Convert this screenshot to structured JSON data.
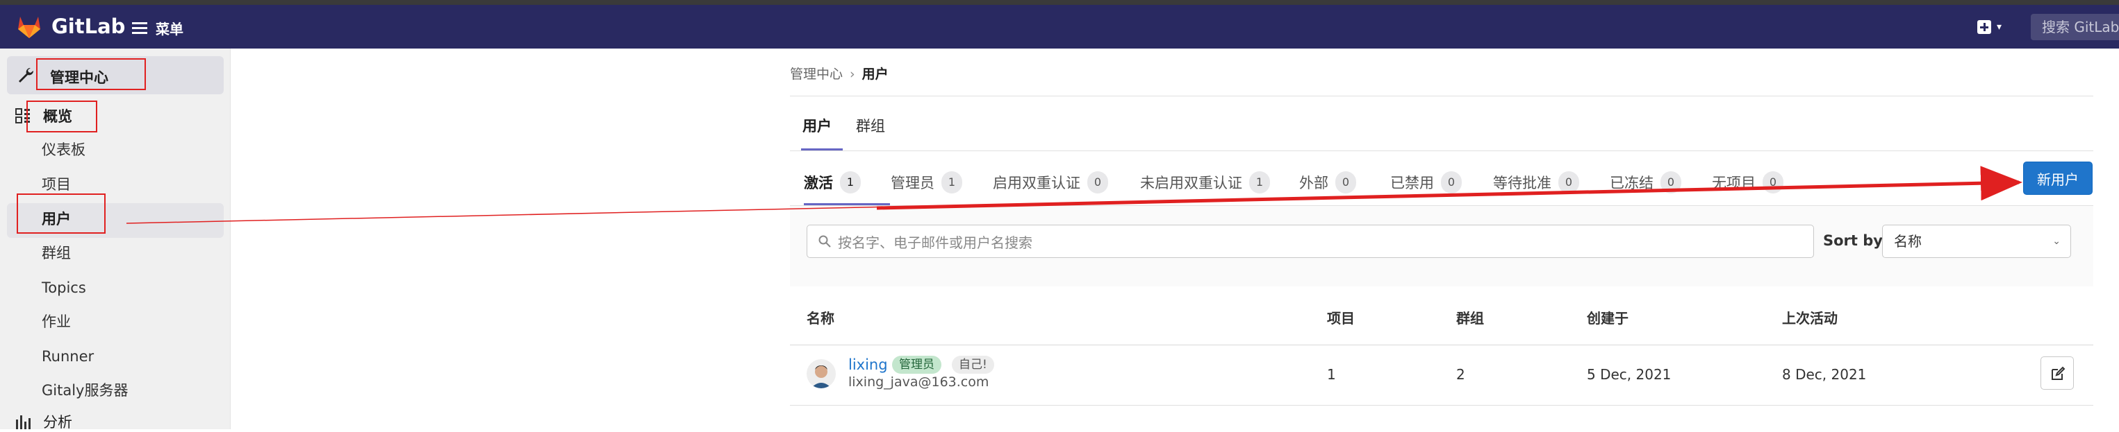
{
  "navbar": {
    "brand": "GitLab",
    "menu_label": "菜单",
    "search_placeholder": "搜索 GitLab"
  },
  "sidebar": {
    "title": "管理中心",
    "section": "概览",
    "items": [
      "仪表板",
      "项目",
      "用户",
      "群组",
      "Topics",
      "作业",
      "Runner",
      "Gitaly服务器"
    ],
    "next_section": "分析"
  },
  "breadcrumb": {
    "parent": "管理中心",
    "current": "用户"
  },
  "top_tabs": [
    "用户",
    "群组"
  ],
  "filter_tabs": [
    {
      "label": "激活",
      "count": "1"
    },
    {
      "label": "管理员",
      "count": "1"
    },
    {
      "label": "启用双重认证",
      "count": "0"
    },
    {
      "label": "未启用双重认证",
      "count": "1"
    },
    {
      "label": "外部",
      "count": "0"
    },
    {
      "label": "已禁用",
      "count": "0"
    },
    {
      "label": "等待批准",
      "count": "0"
    },
    {
      "label": "已冻结",
      "count": "0"
    },
    {
      "label": "无项目",
      "count": "0"
    }
  ],
  "new_user_label": "新用户",
  "search": {
    "placeholder": "按名字、电子邮件或用户名搜索"
  },
  "sort": {
    "label": "Sort by",
    "value": "名称"
  },
  "table": {
    "headers": [
      "名称",
      "项目",
      "群组",
      "创建于",
      "上次活动"
    ],
    "rows": [
      {
        "name": "lixing",
        "admin_badge": "管理员",
        "self_badge": "自己!",
        "email": "lixing_java@163.com",
        "projects": "1",
        "groups": "2",
        "created": "5 Dec, 2021",
        "last_activity": "8 Dec, 2021"
      }
    ]
  },
  "annotation_color": "#e02020",
  "accent": "#1f75cb",
  "navbar_color": "#292961"
}
